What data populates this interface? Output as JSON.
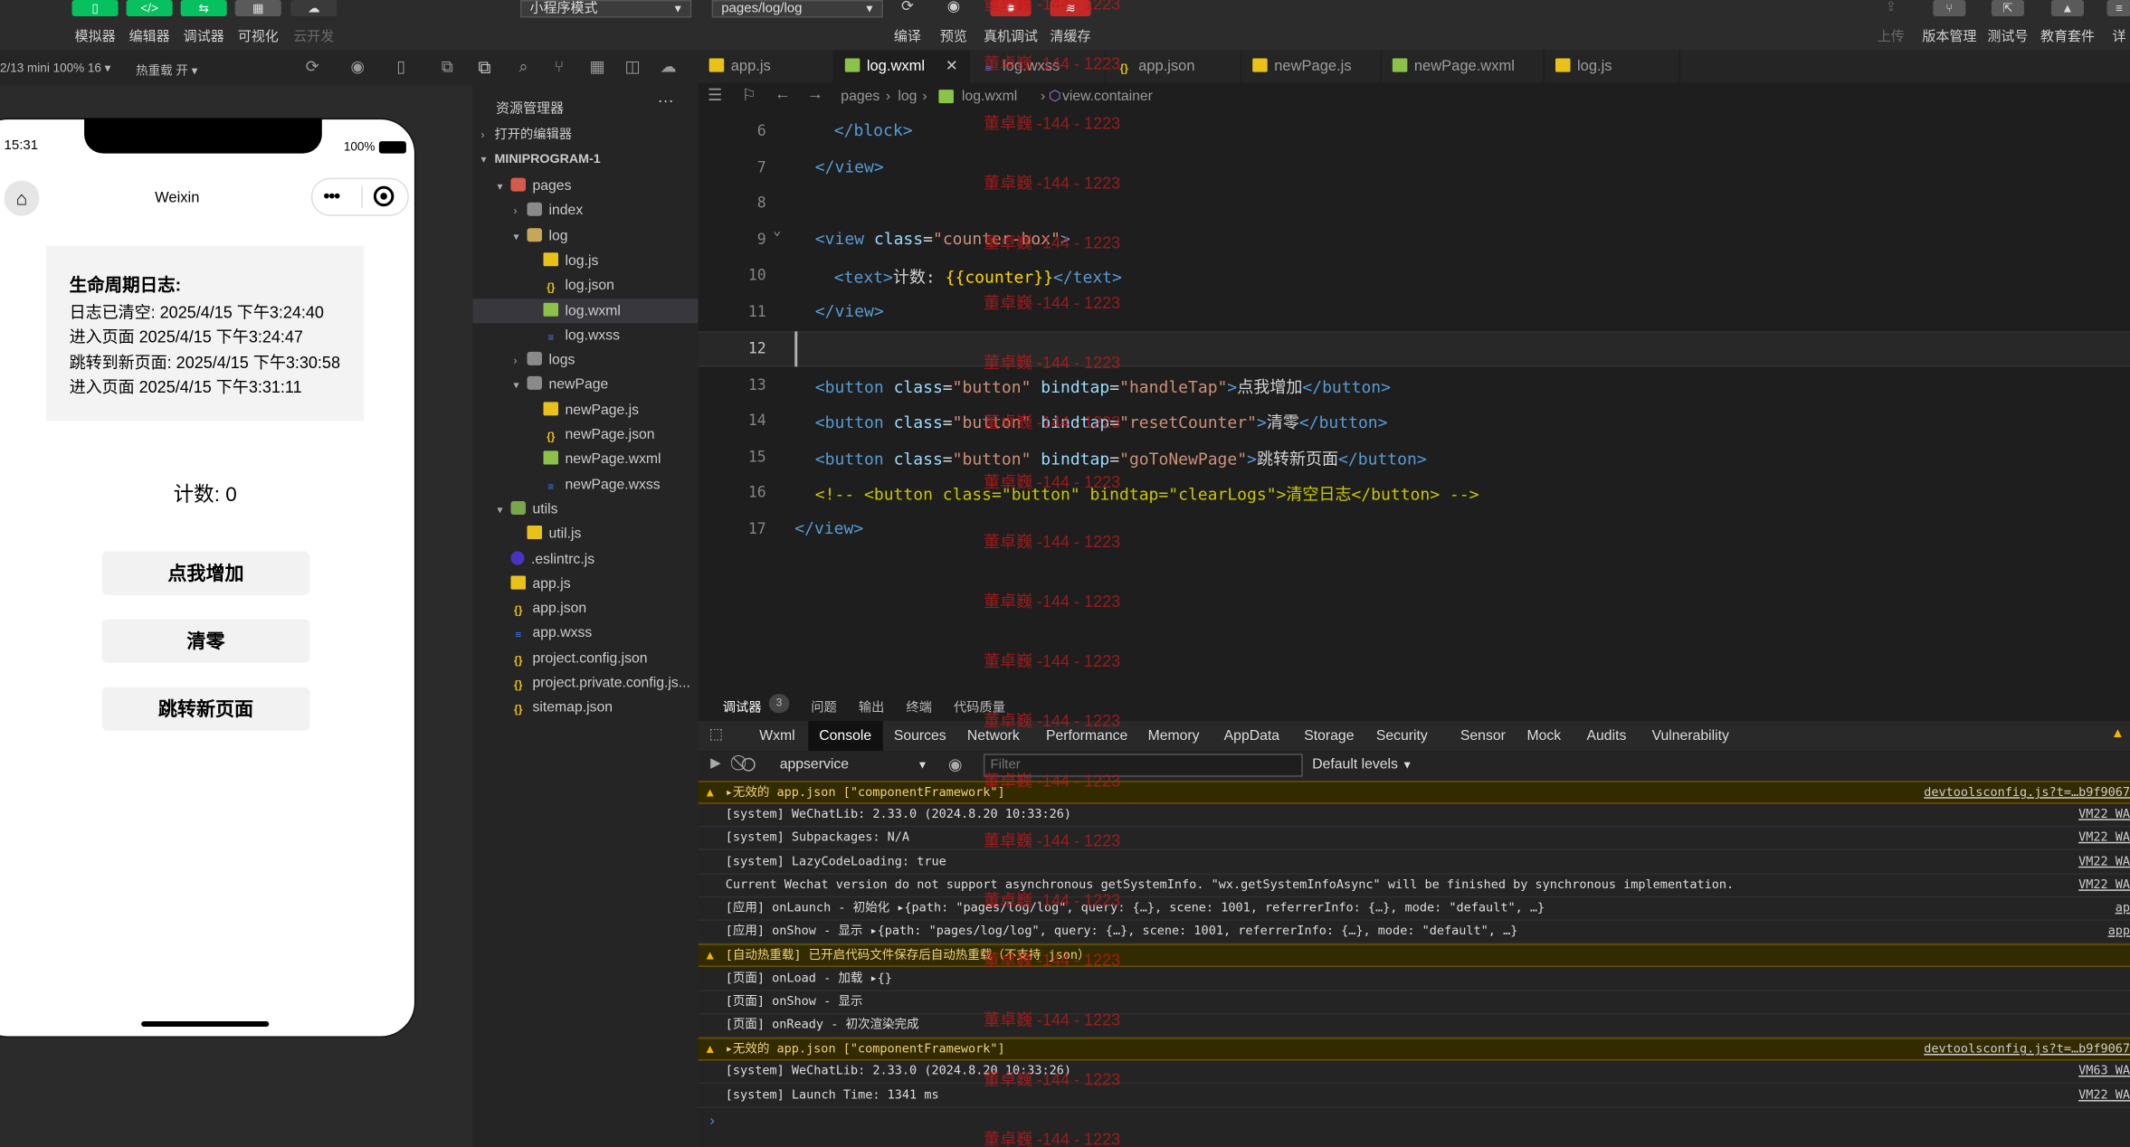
{
  "toolbar": {
    "simulator": "模拟器",
    "editor": "编辑器",
    "debugger": "调试器",
    "visual": "可视化",
    "cloud": "云开发",
    "mode_select": "小程序模式",
    "page_select": "pages/log/log",
    "compile": "编译",
    "preview": "预览",
    "real_debug": "真机调试",
    "clear_cache": "清缓存",
    "upload": "上传",
    "version": "版本管理",
    "test": "测试号",
    "edu": "教育套件",
    "detail": "详"
  },
  "simbar": {
    "device": "2/13 mini 100% 16 ▾",
    "hot_reload": "热重载 开 ▾"
  },
  "phone": {
    "time": "15:31",
    "battery": "100%",
    "nav_title": "Weixin",
    "log_title": "生命周期日志:",
    "logs": [
      "日志已清空: 2025/4/15 下午3:24:40",
      "进入页面 2025/4/15 下午3:24:47",
      "跳转到新页面: 2025/4/15 下午3:30:58",
      "进入页面 2025/4/15 下午3:31:11"
    ],
    "counter": "计数: 0",
    "btn_add": "点我增加",
    "btn_reset": "清零",
    "btn_nav": "跳转新页面"
  },
  "explorer": {
    "title": "资源管理器",
    "open_editors": "打开的编辑器",
    "project": "MINIPROGRAM-1",
    "items": [
      {
        "label": "pages",
        "type": "folder red",
        "arrow": "▾"
      },
      {
        "label": "index",
        "type": "folder",
        "arrow": "›"
      },
      {
        "label": "log",
        "type": "folder yel",
        "arrow": "▾"
      },
      {
        "label": "log.js",
        "type": "js",
        "arrow": ""
      },
      {
        "label": "log.json",
        "type": "json",
        "arrow": ""
      },
      {
        "label": "log.wxml",
        "type": "wxml",
        "arrow": ""
      },
      {
        "label": "log.wxss",
        "type": "wxss",
        "arrow": ""
      },
      {
        "label": "logs",
        "type": "folder",
        "arrow": "›"
      },
      {
        "label": "newPage",
        "type": "folder",
        "arrow": "▾"
      },
      {
        "label": "newPage.js",
        "type": "js",
        "arrow": ""
      },
      {
        "label": "newPage.json",
        "type": "json",
        "arrow": ""
      },
      {
        "label": "newPage.wxml",
        "type": "wxml",
        "arrow": ""
      },
      {
        "label": "newPage.wxss",
        "type": "wxss",
        "arrow": ""
      },
      {
        "label": "utils",
        "type": "folder grn",
        "arrow": "▾"
      },
      {
        "label": "util.js",
        "type": "js",
        "arrow": ""
      },
      {
        "label": ".eslintrc.js",
        "type": "eslint",
        "arrow": ""
      },
      {
        "label": "app.js",
        "type": "js",
        "arrow": ""
      },
      {
        "label": "app.json",
        "type": "json",
        "arrow": ""
      },
      {
        "label": "app.wxss",
        "type": "wxss",
        "arrow": ""
      },
      {
        "label": "project.config.json",
        "type": "json",
        "arrow": ""
      },
      {
        "label": "project.private.config.js...",
        "type": "json",
        "arrow": ""
      },
      {
        "label": "sitemap.json",
        "type": "json",
        "arrow": ""
      }
    ]
  },
  "tabs": [
    "app.js",
    "log.wxml",
    "log.wxss",
    "app.json",
    "newPage.js",
    "newPage.wxml",
    "log.js"
  ],
  "breadcrumb": {
    "a": "pages",
    "b": "log",
    "c": "log.wxml",
    "d": "view.container"
  },
  "code": {
    "l6": "</block>",
    "l7": "</view>",
    "l9_open": "<view",
    "l9_attr": "class",
    "l9_val": "\"counter-box\"",
    "l10_text_open": "<text>",
    "l10_content": "计数: ",
    "l10_expr": "{{counter}}",
    "l10_text_close": "</text>",
    "l11": "</view>",
    "btn1_val": "\"handleTap\"",
    "btn1_label": "点我增加",
    "btn2_val": "\"resetCounter\"",
    "btn2_label": "清零",
    "btn3_val": "\"goToNewPage\"",
    "btn3_label": "跳转新页面",
    "comment": "<!-- <button class=\"button\" bindtap=\"clearLogs\">清空日志</button> -->",
    "l17": "</view>",
    "watermark": "董卓巍 -144 - 1223"
  },
  "devtools": {
    "debugger": "调试器",
    "count": "3",
    "issues": "问题",
    "output": "输出",
    "terminal": "终端",
    "quality": "代码质量",
    "tabs": [
      "Wxml",
      "Console",
      "Sources",
      "Network",
      "Performance",
      "Memory",
      "AppData",
      "Storage",
      "Security",
      "Sensor",
      "Mock",
      "Audits",
      "Vulnerability"
    ],
    "context": "appservice",
    "filter_placeholder": "Filter",
    "levels": "Default levels"
  },
  "console": [
    {
      "warn": true,
      "text": "▸无效的 app.json [\"componentFramework\"]",
      "src": "devtoolsconfig.js?t=…b9f9067"
    },
    {
      "warn": false,
      "text": "[system] WeChatLib: 2.33.0 (2024.8.20 10:33:26)",
      "src": "VM22 WA"
    },
    {
      "warn": false,
      "text": "[system] Subpackages: N/A",
      "src": "VM22 WA"
    },
    {
      "warn": false,
      "text": "[system] LazyCodeLoading: true",
      "src": "VM22 WA"
    },
    {
      "warn": false,
      "text": "Current Wechat version do not support asynchronous getSystemInfo. \"wx.getSystemInfoAsync\" will be finished by synchronous implementation.",
      "src": "VM22 WA"
    },
    {
      "warn": false,
      "text": "[应用] onLaunch - 初始化 ▸{path: \"pages/log/log\", query: {…}, scene: 1001, referrerInfo: {…}, mode: \"default\", …}",
      "src": "ap"
    },
    {
      "warn": false,
      "text": "[应用] onShow - 显示 ▸{path: \"pages/log/log\", query: {…}, scene: 1001, referrerInfo: {…}, mode: \"default\", …}",
      "src": "app"
    },
    {
      "warn": true,
      "text": "[自动热重载] 已开启代码文件保存后自动热重载（不支持 json）",
      "src": ""
    },
    {
      "warn": false,
      "text": "[页面] onLoad - 加载 ▸{}",
      "src": ""
    },
    {
      "warn": false,
      "text": "[页面] onShow - 显示",
      "src": ""
    },
    {
      "warn": false,
      "text": "[页面] onReady - 初次渲染完成",
      "src": ""
    },
    {
      "warn": true,
      "text": "▸无效的 app.json [\"componentFramework\"]",
      "src": "devtoolsconfig.js?t=…b9f9067"
    },
    {
      "warn": false,
      "text": "[system] WeChatLib: 2.33.0 (2024.8.20 10:33:26)",
      "src": "VM63 WA"
    },
    {
      "warn": false,
      "text": "[system] Launch Time: 1341 ms",
      "src": "VM22 WA"
    }
  ],
  "colors": {
    "accent": "#07c160",
    "warn_bg": "#332b00",
    "watermark": "#c41a1a"
  }
}
